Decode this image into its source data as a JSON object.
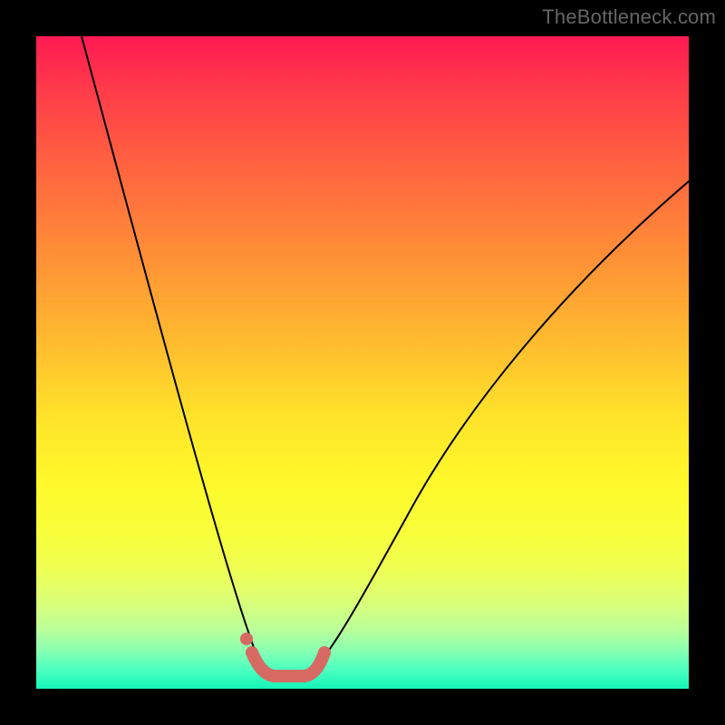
{
  "watermark": {
    "text": "TheBottleneck.com"
  },
  "colors": {
    "curve": "#000000",
    "highlight": "#d66a63",
    "gradient_top": "#ff1a52",
    "gradient_bottom": "#14f5b8",
    "background": "#000000"
  },
  "chart_data": {
    "type": "line",
    "title": "",
    "xlabel": "",
    "ylabel": "",
    "xlim": [
      0,
      1
    ],
    "ylim": [
      0,
      1
    ],
    "series": [
      {
        "name": "bottleneck-curve",
        "x": [
          0.07,
          0.1,
          0.13,
          0.16,
          0.19,
          0.22,
          0.25,
          0.28,
          0.31,
          0.33,
          0.34,
          0.355,
          0.36,
          0.38,
          0.4,
          0.42,
          0.44,
          0.47,
          0.5,
          0.55,
          0.6,
          0.66,
          0.72,
          0.78,
          0.85,
          0.92,
          1.0
        ],
        "y": [
          1.0,
          0.9,
          0.8,
          0.7,
          0.6,
          0.5,
          0.4,
          0.3,
          0.2,
          0.12,
          0.07,
          0.03,
          0.02,
          0.02,
          0.02,
          0.03,
          0.05,
          0.09,
          0.14,
          0.22,
          0.31,
          0.41,
          0.5,
          0.58,
          0.66,
          0.72,
          0.78
        ]
      },
      {
        "name": "optimal-range-highlight",
        "x": [
          0.33,
          0.355,
          0.38,
          0.405,
          0.43
        ],
        "y": [
          0.045,
          0.02,
          0.02,
          0.02,
          0.045
        ]
      }
    ],
    "annotations": [
      {
        "name": "highlight-dot",
        "x": 0.325,
        "y": 0.075
      }
    ]
  }
}
